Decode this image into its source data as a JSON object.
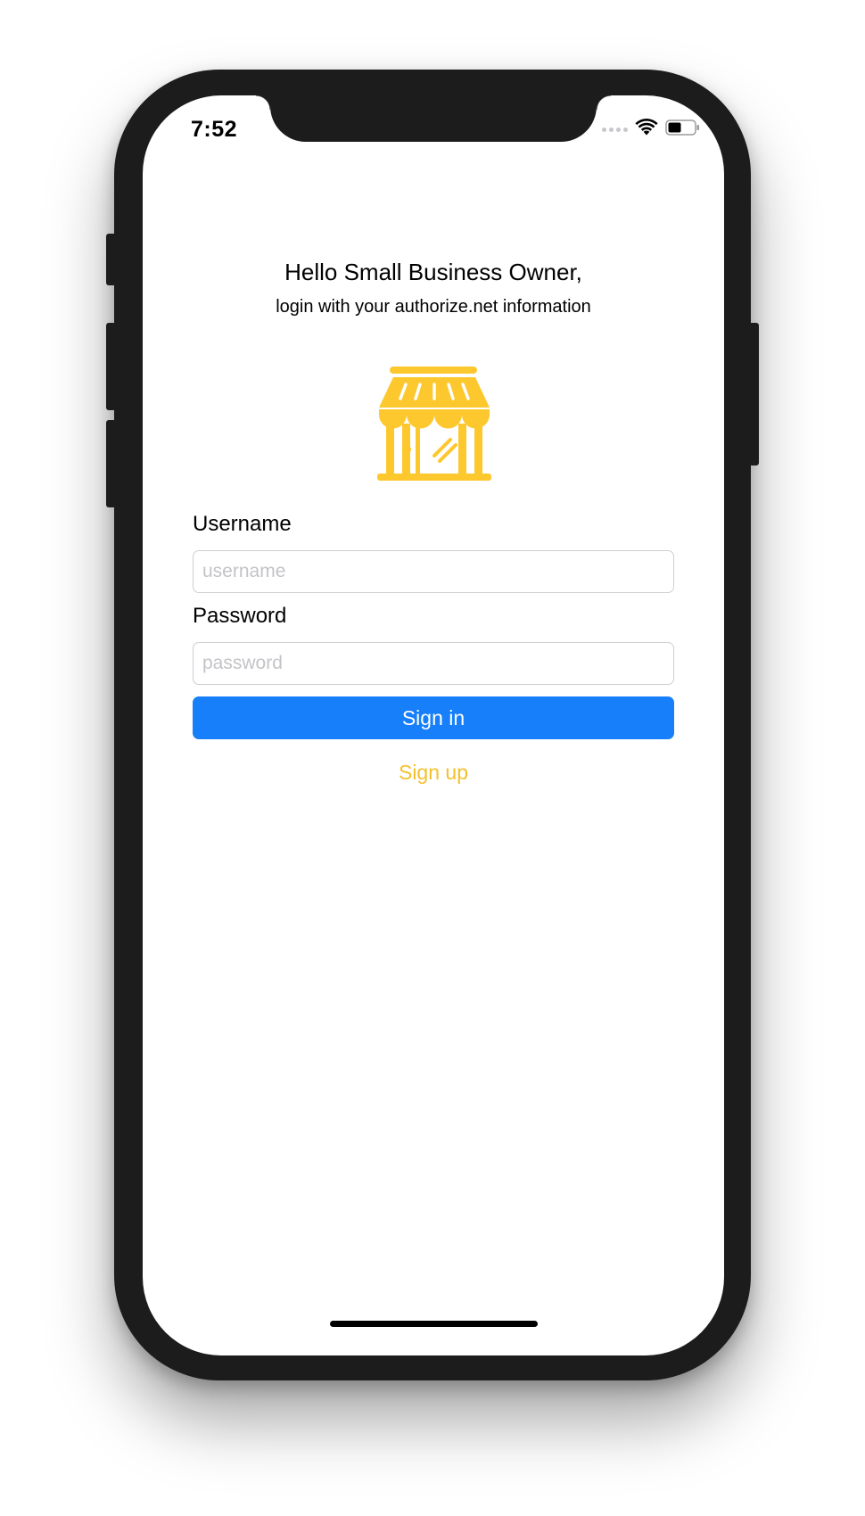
{
  "status_bar": {
    "time": "7:52",
    "icons": [
      "signal-icon",
      "wifi-icon",
      "battery-icon"
    ]
  },
  "header": {
    "greeting": "Hello Small Business Owner,",
    "subtitle": "login with your authorize.net information"
  },
  "logo": {
    "icon": "storefront-icon",
    "color": "#FDC72E"
  },
  "form": {
    "username_label": "Username",
    "username_placeholder": "username",
    "username_value": "",
    "password_label": "Password",
    "password_placeholder": "password",
    "password_value": "",
    "signin_label": "Sign in",
    "signup_label": "Sign up"
  },
  "colors": {
    "primary": "#167FF9",
    "link": "#F3C12B",
    "input_border": "#CFCFD4",
    "placeholder": "#C4C4C8",
    "device_frame": "#1C1C1C"
  }
}
